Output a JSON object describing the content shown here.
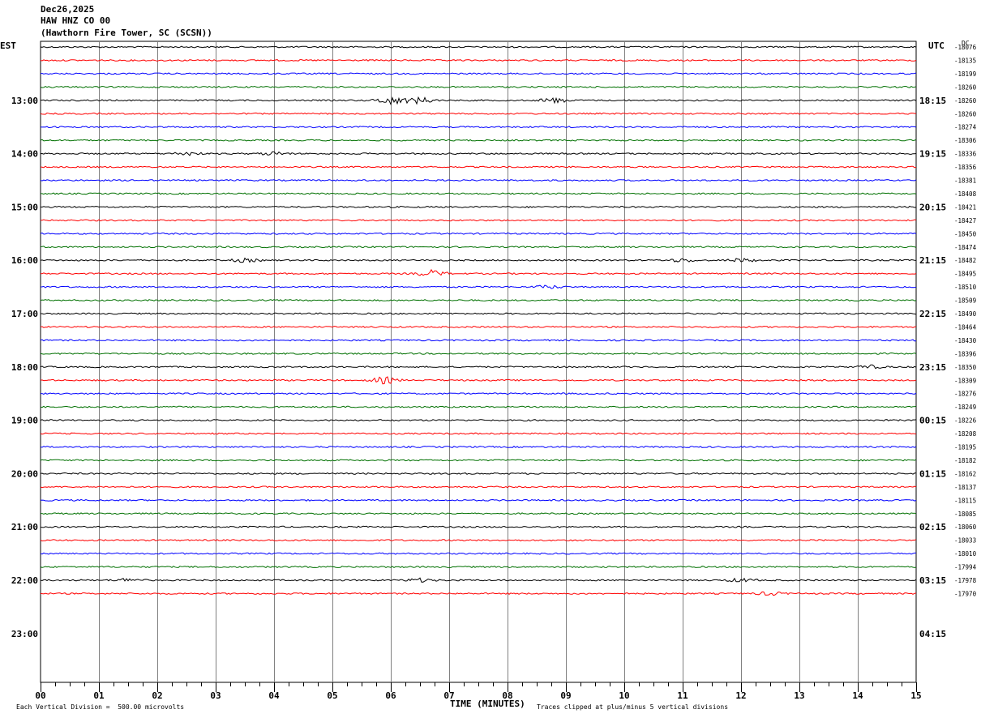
{
  "header": {
    "date": "Dec26,2025",
    "station": "HAW HNZ CO 00",
    "location": "(Hawthorn Fire Tower, SC (SCSN))"
  },
  "left_tz": "EST",
  "right_tz": "UTC",
  "dc_label": "DC",
  "footer": {
    "division": "Each Vertical Division =  500.00 microvolts",
    "xaxis": "TIME (MINUTES)",
    "clip": "Traces clipped at plus/minus 5 vertical divisions"
  },
  "chart_data": {
    "type": "line",
    "title": "",
    "xlabel": "TIME (MINUTES)",
    "xlim": [
      0,
      15
    ],
    "x_ticks": [
      "00",
      "01",
      "02",
      "03",
      "04",
      "05",
      "06",
      "07",
      "08",
      "09",
      "10",
      "11",
      "12",
      "13",
      "14",
      "15"
    ],
    "left_hour_labels": [
      "13:00",
      "14:00",
      "15:00",
      "16:00",
      "17:00",
      "18:00",
      "19:00",
      "20:00",
      "21:00",
      "22:00",
      "23:00"
    ],
    "right_hour_labels": [
      "18:15",
      "19:15",
      "20:15",
      "21:15",
      "22:15",
      "23:15",
      "00:15",
      "01:15",
      "02:15",
      "03:15",
      "04:15"
    ],
    "trace_colors": [
      "#000000",
      "#ff0000",
      "#0000ff",
      "#007000"
    ],
    "trace_count": 42,
    "dc_offsets": [
      -18076,
      -18135,
      -18199,
      -18260,
      -18260,
      -18260,
      -18274,
      -18306,
      -18336,
      -18356,
      -18381,
      -18408,
      -18421,
      -18427,
      -18450,
      -18474,
      -18482,
      -18495,
      -18510,
      -18509,
      -18490,
      -18464,
      -18430,
      -18396,
      -18350,
      -18309,
      -18276,
      -18249,
      -18226,
      -18208,
      -18195,
      -18182,
      -18162,
      -18137,
      -18115,
      -18085,
      -18060,
      -18033,
      -18010,
      -17994,
      -17978,
      -17970
    ],
    "events": [
      {
        "trace": 4,
        "minute": 6.0,
        "amp": 5
      },
      {
        "trace": 4,
        "minute": 6.5,
        "amp": 4
      },
      {
        "trace": 4,
        "minute": 8.8,
        "amp": 3
      },
      {
        "trace": 8,
        "minute": 2.5,
        "amp": 2
      },
      {
        "trace": 8,
        "minute": 4.0,
        "amp": 2
      },
      {
        "trace": 16,
        "minute": 3.5,
        "amp": 2
      },
      {
        "trace": 16,
        "minute": 11.0,
        "amp": 2
      },
      {
        "trace": 16,
        "minute": 12.0,
        "amp": 2
      },
      {
        "trace": 17,
        "minute": 6.7,
        "amp": 4
      },
      {
        "trace": 18,
        "minute": 8.7,
        "amp": 2
      },
      {
        "trace": 25,
        "minute": 5.9,
        "amp": 4
      },
      {
        "trace": 24,
        "minute": 14.2,
        "amp": 2
      },
      {
        "trace": 40,
        "minute": 1.5,
        "amp": 2
      },
      {
        "trace": 40,
        "minute": 6.5,
        "amp": 2
      },
      {
        "trace": 40,
        "minute": 12.0,
        "amp": 2
      },
      {
        "trace": 41,
        "minute": 12.5,
        "amp": 2
      }
    ]
  }
}
